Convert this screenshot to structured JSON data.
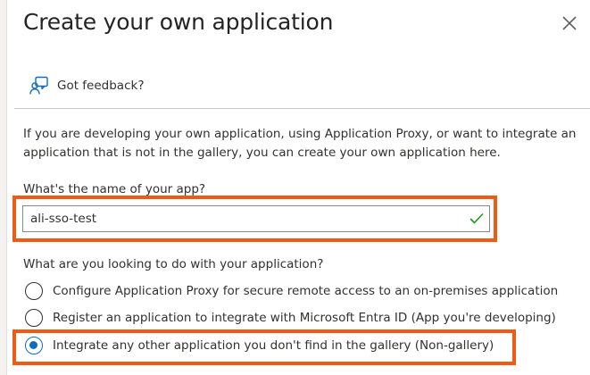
{
  "dialog": {
    "title": "Create your own application",
    "close_icon": "close-icon"
  },
  "feedback": {
    "icon": "feedback-person-icon",
    "label": "Got feedback?"
  },
  "description": "If you are developing your own application, using Application Proxy, or want to integrate an application that is not in the gallery, you can create your own application here.",
  "app_name": {
    "label": "What's the name of your app?",
    "value": "ali-sso-test",
    "valid_icon": "checkmark-icon",
    "valid_color": "#13a10e"
  },
  "purpose": {
    "question": "What are you looking to do with your application?",
    "options": [
      {
        "label": "Configure Application Proxy for secure remote access to an on-premises application",
        "selected": false
      },
      {
        "label": "Register an application to integrate with Microsoft Entra ID (App you're developing)",
        "selected": false
      },
      {
        "label": "Integrate any other application you don't find in the gallery (Non-gallery)",
        "selected": true
      }
    ]
  },
  "colors": {
    "highlight": "#ef5b14",
    "accent": "#0f6cbd",
    "feedback_icon": "#0f6cbd"
  }
}
